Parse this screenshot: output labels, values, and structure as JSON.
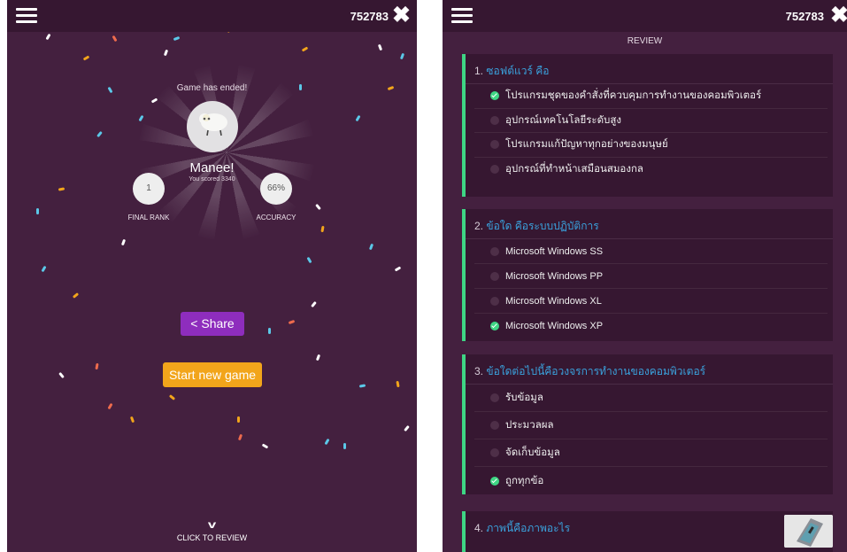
{
  "game_pin": "752783",
  "results": {
    "status": "Game has ended!",
    "nickname": "Manee!",
    "score_text": "You scored 3340",
    "rank_value": "1",
    "rank_label": "FINAL RANK",
    "accuracy_value": "66%",
    "accuracy_label": "ACCURACY",
    "share_label": "Share",
    "new_game_label": "Start new game",
    "review_link": "CLICK TO REVIEW"
  },
  "review": {
    "title": "REVIEW",
    "questions": [
      {
        "num": "1.",
        "text": "ซอฟต์แวร์ คือ",
        "answers": [
          {
            "text": "โปรแกรมชุดของคำสั่งที่ควบคุมการทำงานของคอมพิวเตอร์",
            "correct": true
          },
          {
            "text": "อุปกรณ์เทคโนโลยีระดับสูง",
            "correct": false
          },
          {
            "text": "โปรแกรมแก้ปัญหาทุกอย่างของมนุษย์",
            "correct": false
          },
          {
            "text": "อุปกรณ์ที่ทำหน้าเสมือนสมองกล",
            "correct": false
          }
        ]
      },
      {
        "num": "2.",
        "text": "ข้อใด คือระบบปฏิบัติการ",
        "answers": [
          {
            "text": "Microsoft Windows SS",
            "correct": false
          },
          {
            "text": "Microsoft Windows PP",
            "correct": false
          },
          {
            "text": "Microsoft Windows XL",
            "correct": false
          },
          {
            "text": "Microsoft Windows XP",
            "correct": true
          }
        ]
      },
      {
        "num": "3.",
        "text": "ข้อใดต่อไปนี้คือวงจรการทำงานของคอมพิวเตอร์",
        "answers": [
          {
            "text": "รับข้อมูล",
            "correct": false
          },
          {
            "text": "ประมวลผล",
            "correct": false
          },
          {
            "text": "จัดเก็บข้อมูล",
            "correct": false
          },
          {
            "text": "ถูกทุกข้อ",
            "correct": true
          }
        ]
      },
      {
        "num": "4.",
        "text": "ภาพนี้คือภาพอะไร",
        "answers": []
      }
    ]
  },
  "icons": {
    "menu": "hamburger-icon",
    "close": "close-x-icon",
    "share": "share-icon",
    "review": "chevron-down-icon",
    "correct": "check-circle-icon"
  },
  "colors": {
    "background": "#44203f",
    "bar": "#361731",
    "correct": "#3ed684",
    "question": "#3aa1dc",
    "share": "#8e2dbd",
    "new_game": "#f2a51b"
  }
}
